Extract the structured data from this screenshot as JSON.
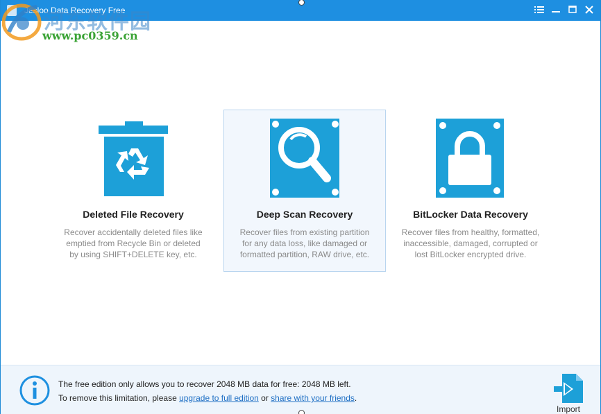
{
  "window": {
    "title": "Jesloo Data Recovery Free",
    "accent_color": "#1e8fe1"
  },
  "watermark": {
    "logo_text": "河东软件园",
    "url": "www.pc0359.cn"
  },
  "controls": {
    "menu_icon": "menu-icon",
    "minimize_icon": "minimize-icon",
    "maximize_icon": "maximize-icon",
    "close_icon": "close-icon"
  },
  "cards": [
    {
      "title": "Deleted File Recovery",
      "desc": [
        "Recover accidentally deleted files like",
        "emptied from Recycle Bin or deleted",
        "by using SHIFT+DELETE key, etc."
      ],
      "icon": "recycle-bin-icon",
      "selected": false
    },
    {
      "title": "Deep Scan Recovery",
      "desc": [
        "Recover files from existing partition",
        "for any data loss, like damaged or",
        "formatted partition, RAW drive, etc."
      ],
      "icon": "magnifier-drive-icon",
      "selected": true
    },
    {
      "title": "BitLocker Data Recovery",
      "desc": [
        "Recover files from healthy, formatted,",
        "inaccessible, damaged, corrupted or",
        "lost BitLocker encrypted drive."
      ],
      "icon": "lock-drive-icon",
      "selected": false
    }
  ],
  "info": {
    "line1": "The free edition only allows you to recover 2048 MB data for free: 2048 MB left.",
    "line2_prefix": "To remove this limitation, please ",
    "upgrade_link": "upgrade to full edition",
    "line2_mid": " or ",
    "share_link": "share with your friends",
    "line2_suffix": ".",
    "import_label": "Import"
  }
}
